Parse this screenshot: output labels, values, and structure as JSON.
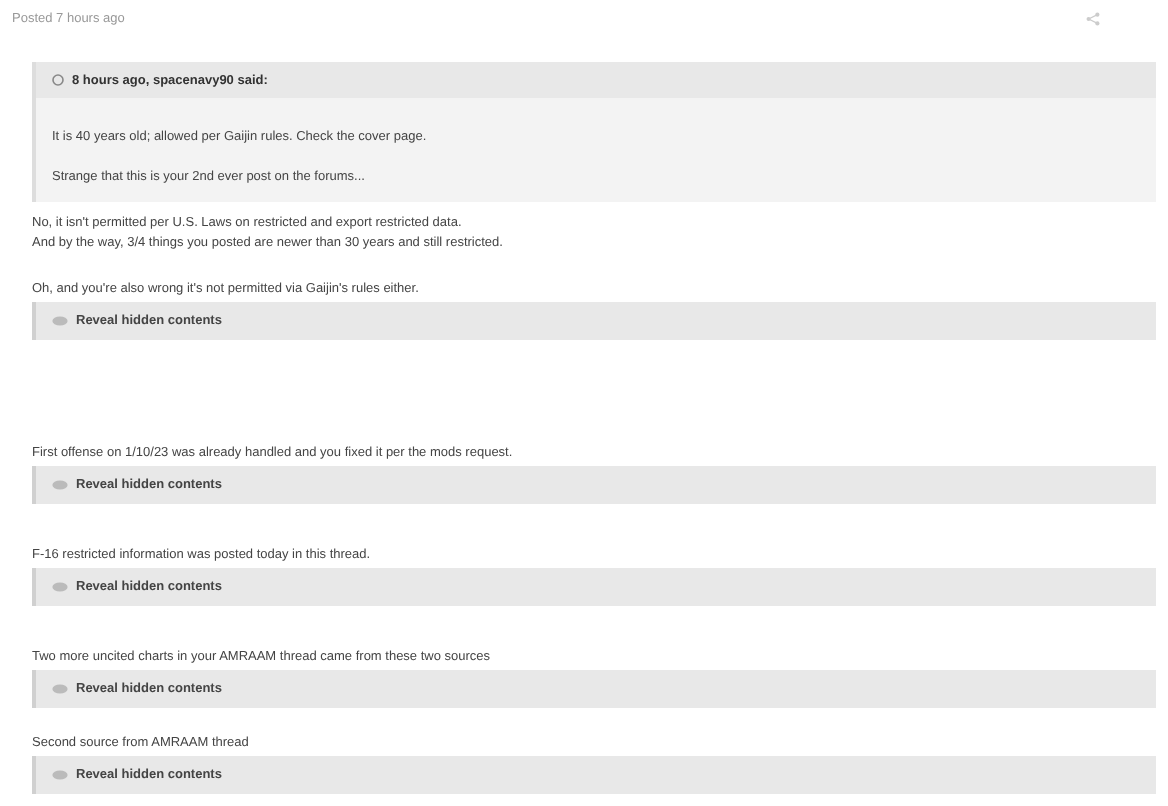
{
  "post_meta": "Posted 7 hours ago",
  "quote": {
    "header": "8 hours ago, spacenavy90 said:",
    "lines": [
      "It is 40 years old; allowed per Gaijin rules. Check the cover page.",
      "Strange that this is your 2nd ever post on the forums..."
    ]
  },
  "blocks": [
    {
      "kind": "text",
      "lines": [
        "No, it isn't permitted per U.S. Laws on restricted and export restricted data.",
        "And by the way, 3/4 things you posted are newer than 30 years and still restricted."
      ]
    },
    {
      "kind": "text",
      "lines": [
        "Oh, and you're also wrong it's not permitted via Gaijin's rules either."
      ]
    },
    {
      "kind": "spoiler",
      "label": "Reveal hidden contents"
    },
    {
      "kind": "text",
      "lines": [
        "First offense on 1/10/23 was already handled and you fixed it per the mods request."
      ]
    },
    {
      "kind": "spoiler",
      "label": "Reveal hidden contents"
    },
    {
      "kind": "text",
      "lines": [
        "F-16 restricted information was posted today in this thread."
      ]
    },
    {
      "kind": "spoiler",
      "label": "Reveal hidden contents"
    },
    {
      "kind": "text",
      "lines": [
        "Two more uncited charts in your AMRAAM thread came from these two sources"
      ]
    },
    {
      "kind": "spoiler",
      "label": "Reveal hidden contents"
    },
    {
      "kind": "text",
      "lines": [
        "Second source from AMRAAM thread"
      ]
    },
    {
      "kind": "spoiler",
      "label": "Reveal hidden contents"
    }
  ]
}
